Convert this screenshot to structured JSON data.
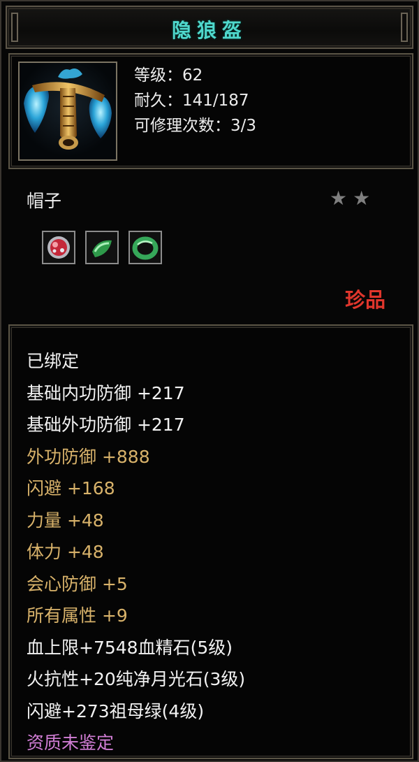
{
  "item": {
    "name": "隐狼盔",
    "icon": "helmet-icon",
    "level": "等级：62",
    "durability": "耐久：141/187",
    "repairs": "可修理次数：3/3",
    "type": "帽子",
    "stars": 2,
    "rarity": "珍品",
    "rarity_color": "#e0362c"
  },
  "gems": [
    {
      "icon": "red-gem-icon"
    },
    {
      "icon": "green-gem-icon"
    },
    {
      "icon": "jade-ring-icon"
    }
  ],
  "attributes": [
    {
      "text": "已绑定",
      "color": "white"
    },
    {
      "text": "基础内功防御  +217",
      "color": "white"
    },
    {
      "text": "基础外功防御  +217",
      "color": "white"
    },
    {
      "text": "外功防御  +888",
      "color": "gold"
    },
    {
      "text": "闪避  +168",
      "color": "gold"
    },
    {
      "text": "力量  +48",
      "color": "gold"
    },
    {
      "text": "体力  +48",
      "color": "gold"
    },
    {
      "text": "会心防御  +5",
      "color": "gold"
    },
    {
      "text": "所有属性  +9",
      "color": "gold"
    },
    {
      "text": "血上限+7548血精石(5级)",
      "color": "white"
    },
    {
      "text": "火抗性+20纯净月光石(3级)",
      "color": "white"
    },
    {
      "text": "闪避+273祖母绿(4级)",
      "color": "white"
    },
    {
      "text": "资质未鉴定",
      "color": "purple"
    }
  ],
  "colors": {
    "title": "#4fd8cc",
    "gold_text": "#d8b26a",
    "purple_text": "#d27ed6"
  }
}
